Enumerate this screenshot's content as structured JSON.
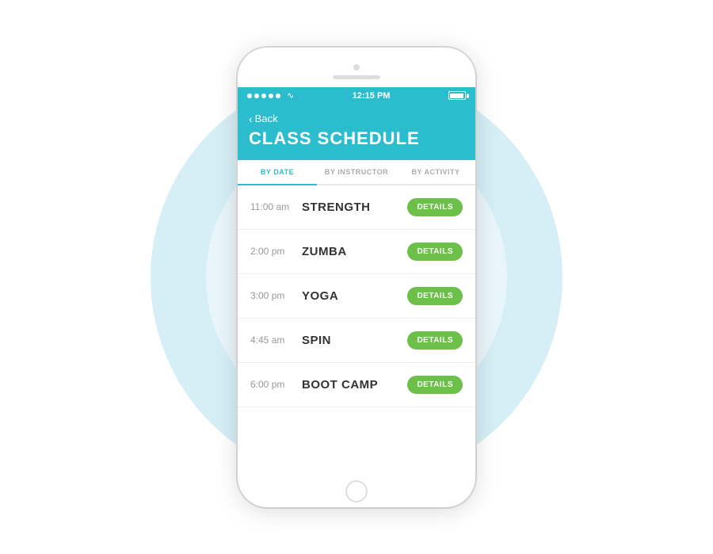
{
  "scene": {
    "bg_color": "#ffffff"
  },
  "phone": {
    "status_bar": {
      "time": "12:15 PM",
      "dots_count": 5,
      "wifi_label": "WiFi",
      "battery_label": "Battery"
    },
    "header": {
      "back_label": "Back",
      "title": "CLASS SCHEDULE"
    },
    "tabs": [
      {
        "id": "by-date",
        "label": "BY DATE",
        "active": true
      },
      {
        "id": "by-instructor",
        "label": "BY INSTRUCTOR",
        "active": false
      },
      {
        "id": "by-activity",
        "label": "BY ACTIVITY",
        "active": false
      }
    ],
    "schedule": [
      {
        "time": "11:00 am",
        "name": "STRENGTH",
        "btn_label": "DETAILS"
      },
      {
        "time": "2:00 pm",
        "name": "ZUMBA",
        "btn_label": "DETAILS"
      },
      {
        "time": "3:00 pm",
        "name": "YOGA",
        "btn_label": "DETAILS"
      },
      {
        "time": "4:45 am",
        "name": "SPIN",
        "btn_label": "DETAILS"
      },
      {
        "time": "6:00 pm",
        "name": "BOOT CAMP",
        "btn_label": "DETAILS"
      }
    ]
  },
  "colors": {
    "accent": "#2bbdce",
    "green": "#6cc04a",
    "text_dark": "#333333",
    "text_muted": "#999999",
    "bg_circle": "#d6eef5"
  }
}
